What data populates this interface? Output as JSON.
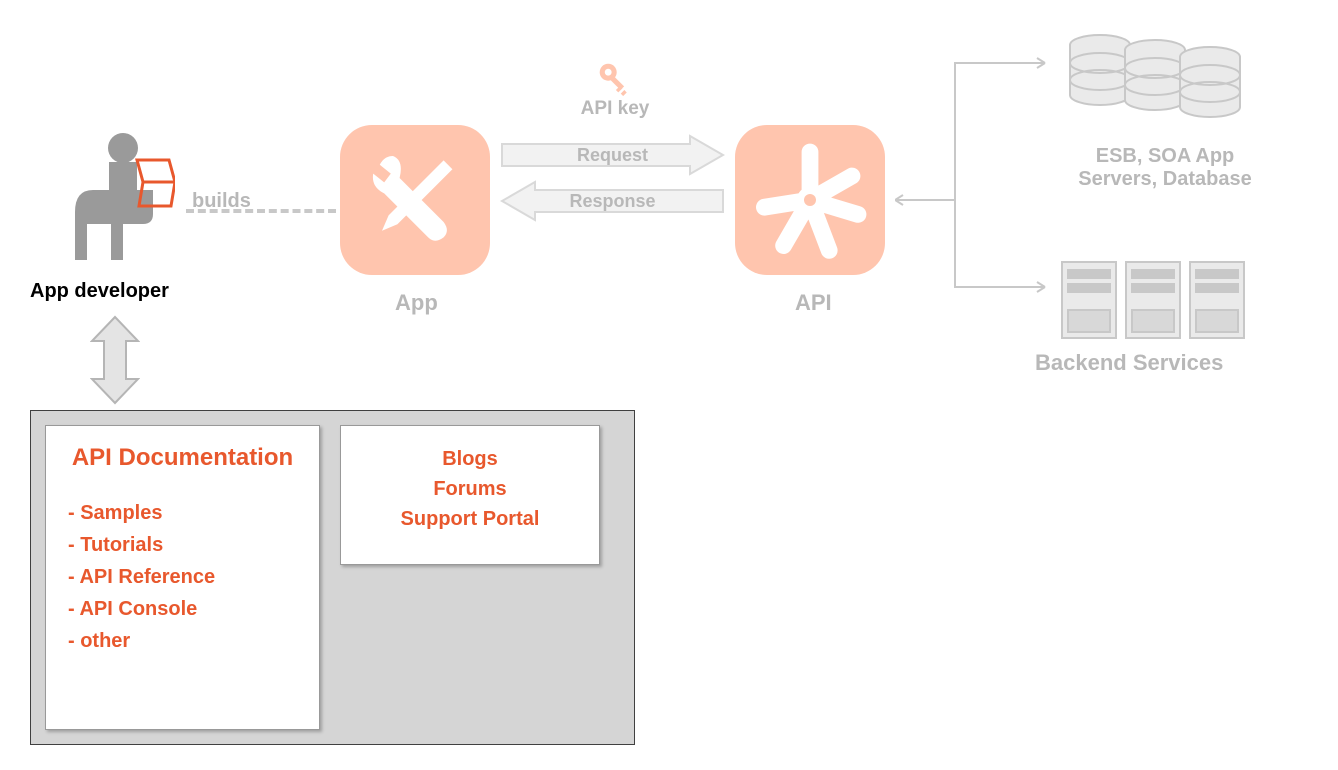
{
  "developer": {
    "label": "App developer"
  },
  "builds": "builds",
  "app": {
    "label": "App"
  },
  "api": {
    "label": "API"
  },
  "api_key": "API key",
  "request": "Request",
  "response": "Response",
  "backend": {
    "upper": "ESB, SOA App Servers, Database",
    "title": "Backend Services"
  },
  "portal": {
    "doc": {
      "title": "API Documentation",
      "items": [
        "- Samples",
        "- Tutorials",
        "- API Reference",
        "- API Console",
        "- other"
      ]
    },
    "community": {
      "lines": [
        "Blogs",
        "Forums",
        "Support Portal"
      ]
    }
  },
  "colors": {
    "orange_light": "#ffc5ae",
    "orange": "#e8582d",
    "gray": "#b8b8b8"
  }
}
